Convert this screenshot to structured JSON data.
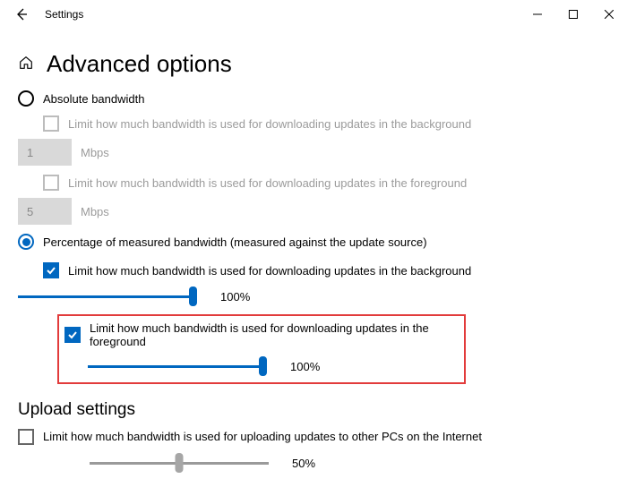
{
  "window": {
    "title": "Settings"
  },
  "page": {
    "title": "Advanced options"
  },
  "options": {
    "absolute_label": "Absolute bandwidth",
    "abs_bg_label": "Limit how much bandwidth is used for downloading updates in the background",
    "abs_bg_value": "1",
    "abs_bg_unit": "Mbps",
    "abs_fg_label": "Limit how much bandwidth is used for downloading updates in the foreground",
    "abs_fg_value": "5",
    "abs_fg_unit": "Mbps",
    "percent_label": "Percentage of measured bandwidth (measured against the update source)",
    "pct_bg_label": "Limit how much bandwidth is used for downloading updates in the background",
    "pct_bg_value": "100%",
    "pct_fg_label": "Limit how much bandwidth is used for downloading updates in the foreground",
    "pct_fg_value": "100%"
  },
  "upload": {
    "section_title": "Upload settings",
    "limit_label": "Limit how much bandwidth is used for uploading updates to other PCs on the Internet",
    "slider_value": "50%"
  }
}
